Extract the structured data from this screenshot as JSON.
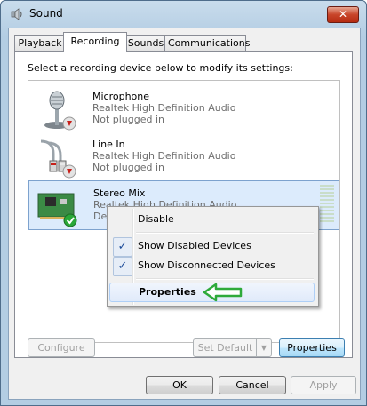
{
  "window": {
    "title": "Sound",
    "close_label": "✕"
  },
  "tabs": [
    {
      "label": "Playback",
      "active": false
    },
    {
      "label": "Recording",
      "active": true
    },
    {
      "label": "Sounds",
      "active": false
    },
    {
      "label": "Communications",
      "active": false
    }
  ],
  "instruction": "Select a recording device below to modify its settings:",
  "devices": [
    {
      "name": "Microphone",
      "driver": "Realtek High Definition Audio",
      "status": "Not plugged in",
      "icon": "microphone-icon",
      "badge": "red-down-arrow"
    },
    {
      "name": "Line In",
      "driver": "Realtek High Definition Audio",
      "status": "Not plugged in",
      "icon": "line-in-cable-icon",
      "badge": "red-down-arrow"
    },
    {
      "name": "Stereo Mix",
      "driver": "Realtek High Definition Audio",
      "status": "Defa",
      "icon": "sound-card-icon",
      "badge": "green-check",
      "selected": true
    }
  ],
  "context_menu": {
    "items": [
      {
        "label": "Disable",
        "checked": false
      },
      {
        "label": "Show Disabled Devices",
        "checked": true
      },
      {
        "label": "Show Disconnected Devices",
        "checked": true
      },
      {
        "label": "Properties",
        "bold": true,
        "highlighted": true
      }
    ],
    "check_glyph": "✓"
  },
  "buttons": {
    "configure": "Configure",
    "set_default": "Set Default",
    "properties": "Properties",
    "ok": "OK",
    "cancel": "Cancel",
    "apply": "Apply"
  },
  "colors": {
    "title_bar": "#b3cde3",
    "selection": "#dcebfc",
    "annotation_arrow": "#2eaa3a",
    "close_button": "#c8452a"
  }
}
